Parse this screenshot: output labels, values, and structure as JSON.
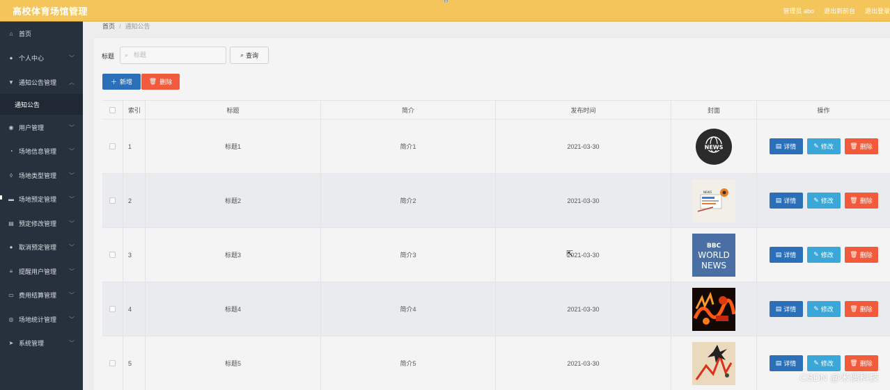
{
  "app": {
    "title": "高校体育场馆管理"
  },
  "topbar": {
    "user": "管理员 abo",
    "back_to_front": "退出到前台",
    "logout": "退出登录"
  },
  "sidebar": {
    "items": [
      {
        "label": "首页",
        "icon": "home-icon"
      },
      {
        "label": "个人中心",
        "icon": "user-icon"
      },
      {
        "label": "通知公告管理",
        "icon": "bell-icon"
      },
      {
        "label": "用户管理",
        "icon": "location-icon"
      },
      {
        "label": "场地信息管理",
        "icon": "clock-icon"
      },
      {
        "label": "场地类型管理",
        "icon": "mic-icon"
      },
      {
        "label": "场地预定管理",
        "icon": "message-icon"
      },
      {
        "label": "预定修改管理",
        "icon": "printer-icon"
      },
      {
        "label": "取消预定管理",
        "icon": "person-icon"
      },
      {
        "label": "提醒用户管理",
        "icon": "list-icon"
      },
      {
        "label": "费用结算管理",
        "icon": "chat-icon"
      },
      {
        "label": "场地统计管理",
        "icon": "globe-icon"
      },
      {
        "label": "系统管理",
        "icon": "send-icon"
      }
    ],
    "sub_item": "通知公告"
  },
  "breadcrumb": {
    "home": "首页",
    "current": "通知公告"
  },
  "search": {
    "label": "标题",
    "placeholder": "标题",
    "query_button": "查询"
  },
  "toolbar": {
    "add_label": "新增",
    "delete_label": "删除"
  },
  "table": {
    "headers": [
      "索引",
      "标题",
      "简介",
      "发布时间",
      "封面",
      "操作"
    ],
    "actions": {
      "detail": "详情",
      "edit": "修改",
      "remove": "删除"
    },
    "rows": [
      {
        "index": "1",
        "title": "标题1",
        "intro": "简介1",
        "date": "2021-03-30",
        "cover": "news-globe-image"
      },
      {
        "index": "2",
        "title": "标题2",
        "intro": "简介2",
        "date": "2021-03-30",
        "cover": "news-laptop-image"
      },
      {
        "index": "3",
        "title": "标题3",
        "intro": "简介3",
        "date": "2021-03-30",
        "cover": "bbc-world-news-image",
        "cover_text": [
          "BBC",
          "WORLD",
          "NEWS"
        ]
      },
      {
        "index": "4",
        "title": "标题4",
        "intro": "简介4",
        "date": "2021-03-30",
        "cover": "dow-jones-image"
      },
      {
        "index": "5",
        "title": "标题5",
        "intro": "简介5",
        "date": "2021-03-30",
        "cover": "market-chart-image"
      }
    ]
  },
  "watermark": "CSDN @米偶科技",
  "colors": {
    "topbar": "#f3c55a",
    "sidebar": "#27313d",
    "primary": "#2a6fb8",
    "info": "#3aa7d8",
    "danger": "#f15a3a"
  }
}
